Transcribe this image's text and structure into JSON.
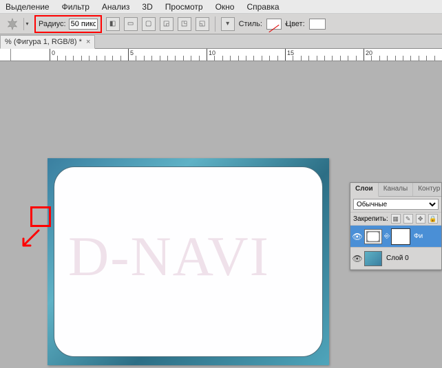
{
  "menu": [
    "Выделение",
    "Фильтр",
    "Анализ",
    "3D",
    "Просмотр",
    "Окно",
    "Справка"
  ],
  "options": {
    "radius_label": "Радиус:",
    "radius_value": "50 пикс",
    "style_label": "Стиль:",
    "color_label": "Цвет:"
  },
  "document": {
    "tab_title": "% (Фигура 1, RGB/8) *",
    "close": "×"
  },
  "ruler": {
    "ticks": [
      "0",
      "5",
      "10",
      "15",
      "20"
    ]
  },
  "watermark": "D-NAVI",
  "panel": {
    "tabs": [
      "Слои",
      "Каналы",
      "Контур"
    ],
    "blend_mode": "Обычные",
    "lock_label": "Закрепить:",
    "layers": [
      {
        "name": "Фи",
        "active": true,
        "thumb": "shape"
      },
      {
        "name": "Слой 0",
        "active": false,
        "thumb": "img"
      }
    ]
  }
}
